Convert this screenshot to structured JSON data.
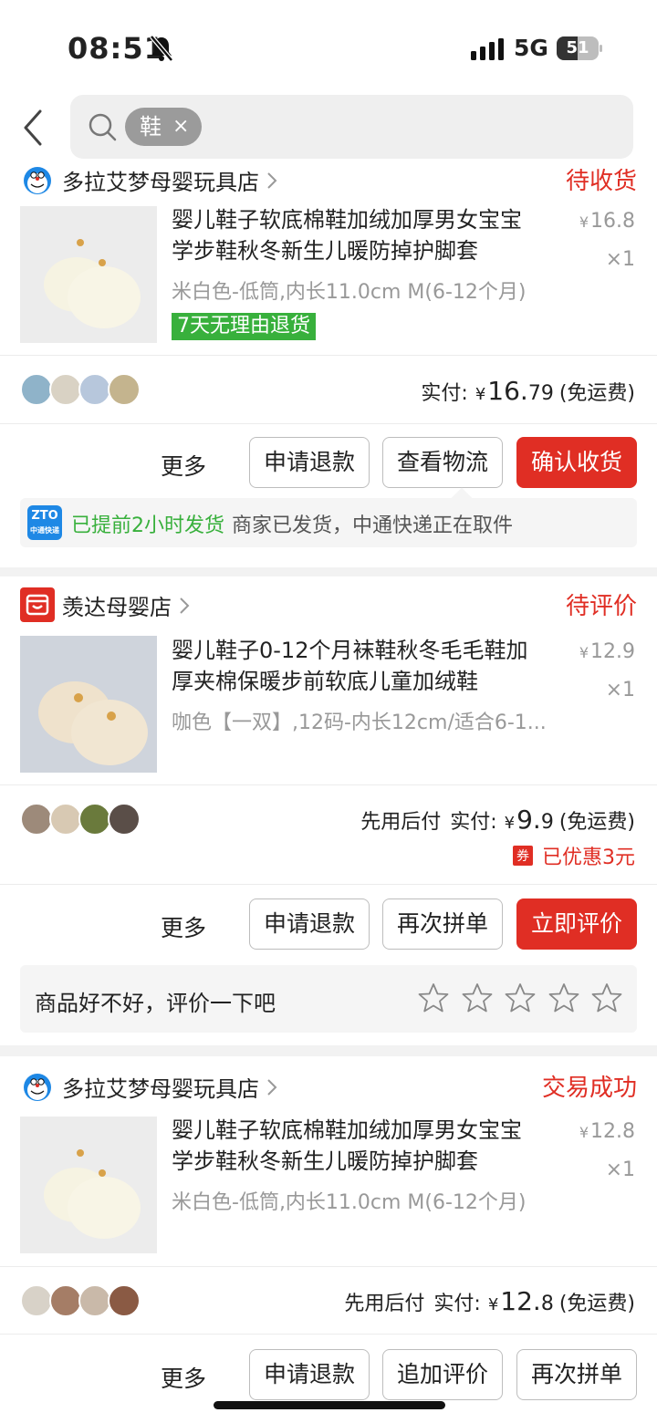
{
  "status_bar": {
    "time": "08:51",
    "network": "5G",
    "battery": "51",
    "battery_level": 0.51,
    "bell_icon": "bell-slash-icon"
  },
  "header": {
    "search_chip": "鞋",
    "chip_close": "×"
  },
  "orders": [
    {
      "shop_name": "多拉艾梦母婴玩具店",
      "status": "待收货",
      "title_line1": "婴儿鞋子软底棉鞋加绒加厚男女宝宝",
      "title_line2": "学步鞋秋冬新生儿暖防掉护脚套",
      "spec": "米白色-低筒,内长11.0cm M(6-12个月)",
      "unit_currency": "¥",
      "unit_price": "16.8",
      "qty": "×1",
      "return_tag": "7天无理由退货",
      "paid_label": "实付:",
      "paid_currency": "¥",
      "paid_int": "16.",
      "paid_dec": "79",
      "shipping": "(免运费)",
      "more": "更多",
      "buttons": [
        "申请退款",
        "查看物流",
        "确认收货"
      ],
      "logistics_highlight": "已提前2小时发货",
      "logistics_text": "商家已发货，中通快递正在取件",
      "zto_logo": "ZTO",
      "zto_sub": "中通快递"
    },
    {
      "shop_name": "羡达母婴店",
      "status": "待评价",
      "title_line1": "婴儿鞋子0-12个月袜鞋秋冬毛毛鞋加",
      "title_line2": "厚夹棉保暖步前软底儿童加绒鞋",
      "spec": "咖色【一双】,12码-内长12cm/适合6-1...",
      "unit_currency": "¥",
      "unit_price": "12.9",
      "qty": "×1",
      "pay_later": "先用后付",
      "paid_label": "实付:",
      "paid_currency": "¥",
      "paid_int": "9.",
      "paid_dec": "9",
      "shipping": "(免运费)",
      "coupon_badge": "券",
      "coupon_text": "已优惠3元",
      "more": "更多",
      "buttons": [
        "申请退款",
        "再次拼单",
        "立即评价"
      ],
      "review_prompt": "商品好不好，评价一下吧",
      "review_stars": 0,
      "review_max_stars": 5
    },
    {
      "shop_name": "多拉艾梦母婴玩具店",
      "status": "交易成功",
      "title_line1": "婴儿鞋子软底棉鞋加绒加厚男女宝宝",
      "title_line2": "学步鞋秋冬新生儿暖防掉护脚套",
      "spec": "米白色-低筒,内长11.0cm M(6-12个月)",
      "unit_currency": "¥",
      "unit_price": "12.8",
      "qty": "×1",
      "pay_later": "先用后付",
      "paid_label": "实付:",
      "paid_currency": "¥",
      "paid_int": "12.",
      "paid_dec": "8",
      "shipping": "(免运费)",
      "more": "更多",
      "buttons": [
        "申请退款",
        "追加评价",
        "再次拼单"
      ]
    }
  ],
  "colors": {
    "accent": "#e02e24",
    "green": "#38b03c",
    "muted": "#999999",
    "background": "#f2f2f2"
  }
}
